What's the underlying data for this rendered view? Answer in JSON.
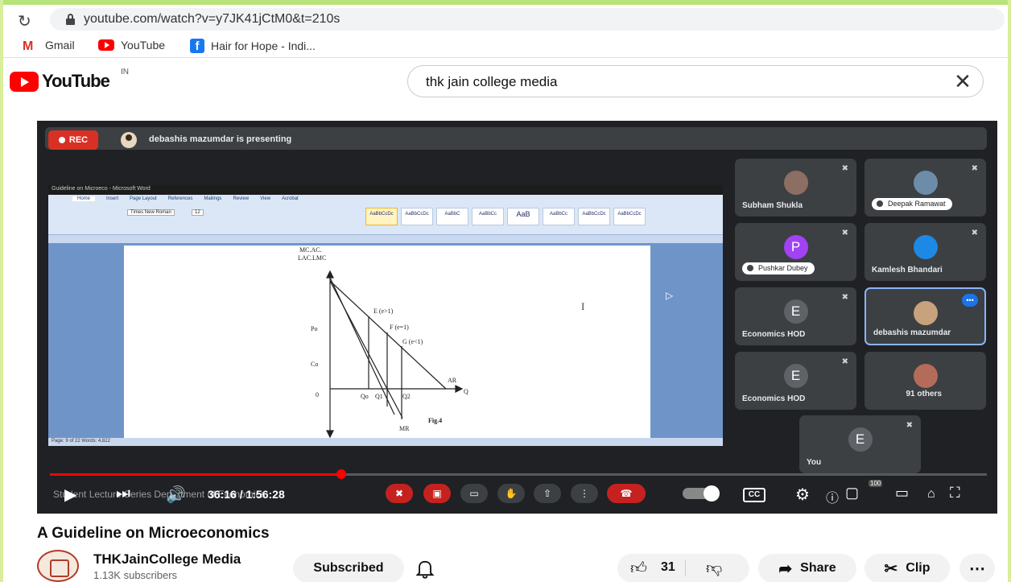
{
  "browser": {
    "url": "youtube.com/watch?v=y7JK41jCtM0&t=210s",
    "bookmarks": [
      "Gmail",
      "YouTube",
      "Hair for Hope - Indi..."
    ]
  },
  "youtube": {
    "logo_text": "YouTube",
    "country_code": "IN",
    "search_value": "thk jain college media"
  },
  "meet": {
    "rec_label": "REC",
    "presenting_text": "debashis mazumdar is presenting",
    "participants": [
      {
        "name": "Subham Shukla",
        "initial": "",
        "color": "#8d6e63",
        "muted": true
      },
      {
        "name": "Deepak Ramawat",
        "initial": "",
        "color": "#6d8ca8",
        "muted": true
      },
      {
        "name": "Pushkar Dubey",
        "initial": "P",
        "color": "#a142f4",
        "muted": true
      },
      {
        "name": "Kamlesh Bhandari",
        "initial": "",
        "color": "#1e88e5",
        "muted": true
      },
      {
        "name": "Economics HOD",
        "initial": "E",
        "color": "#5f6368",
        "muted": true
      },
      {
        "name": "debashis mazumdar",
        "initial": "",
        "color": "#c8a27c",
        "muted": false
      },
      {
        "name": "Economics HOD",
        "initial": "E",
        "color": "#5f6368",
        "muted": true
      },
      {
        "name": "91 others",
        "initial": "",
        "color": "#b56b5a",
        "muted": false
      },
      {
        "name": "You",
        "initial": "E",
        "color": "#5f6368",
        "muted": true
      }
    ]
  },
  "shared_doc": {
    "window_title": "Guideline on Microeco - Microsoft Word",
    "tabs": [
      "Home",
      "Insert",
      "Page Layout",
      "References",
      "Mailings",
      "Review",
      "View",
      "Acrobat"
    ],
    "font_name": "Times New Roman",
    "font_size": "12",
    "styles": [
      "AaBbCcDc",
      "AaBbCcDc",
      "AaBbC",
      "AaBbCc",
      "AaB",
      "AaBbCc",
      "AaBbCcDc",
      "AaBbCcDc"
    ],
    "status_text": "Page: 9 of 22   Words: 4,822",
    "figure": {
      "y_axis_label_1": "MC.AC.",
      "y_axis_label_2": "LAC.LMC",
      "labels": [
        "E (e>1)",
        "F (e=1)",
        "G (e<1)",
        "Po",
        "Co",
        "0",
        "Qo",
        "Q1",
        "Q2",
        "Q",
        "AR",
        "MR",
        "Fig.4"
      ]
    }
  },
  "player": {
    "chapter_text": "Student Lecture Series Department of Economics",
    "time_current": "36:16",
    "time_total": "1:56:28",
    "time_display": "36:16 / 1:56:28",
    "progress": 0.311,
    "cc_label": "CC",
    "hd_badge": "100"
  },
  "video": {
    "title": "A Guideline on Microeconomics",
    "channel": "THKJainCollege Media",
    "subscribers": "1.13K subscribers",
    "subscribed_label": "Subscribed",
    "likes": "31",
    "share_label": "Share",
    "clip_label": "Clip"
  }
}
